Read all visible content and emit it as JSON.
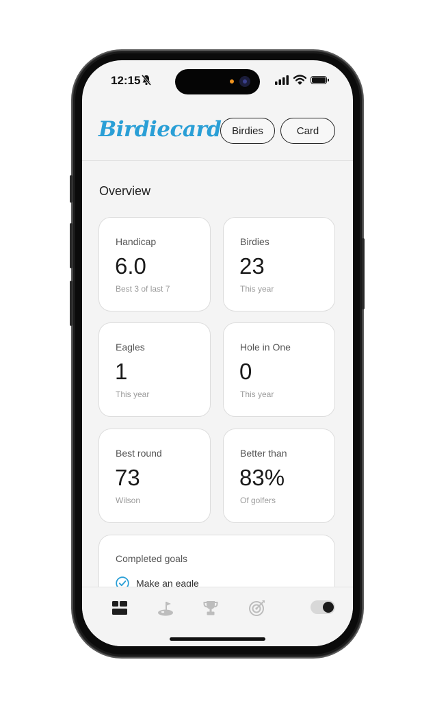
{
  "status": {
    "time": "12:15"
  },
  "header": {
    "logo": "Birdiecard",
    "birdies_label": "Birdies",
    "card_label": "Card"
  },
  "overview": {
    "title": "Overview",
    "stats": [
      {
        "label": "Handicap",
        "value": "6.0",
        "sub": "Best 3 of last 7"
      },
      {
        "label": "Birdies",
        "value": "23",
        "sub": "This year"
      },
      {
        "label": "Eagles",
        "value": "1",
        "sub": "This year"
      },
      {
        "label": "Hole in One",
        "value": "0",
        "sub": "This year"
      },
      {
        "label": "Best round",
        "value": "73",
        "sub": "Wilson"
      },
      {
        "label": "Better than",
        "value": "83%",
        "sub": "Of golfers"
      }
    ]
  },
  "goals": {
    "title": "Completed goals",
    "items": [
      "Make an eagle"
    ]
  },
  "tabs": [
    "dashboard-icon",
    "golf-hole-icon",
    "trophy-icon",
    "target-icon"
  ],
  "theme": {
    "accent": "#2a9fd6",
    "dark_mode": true
  }
}
